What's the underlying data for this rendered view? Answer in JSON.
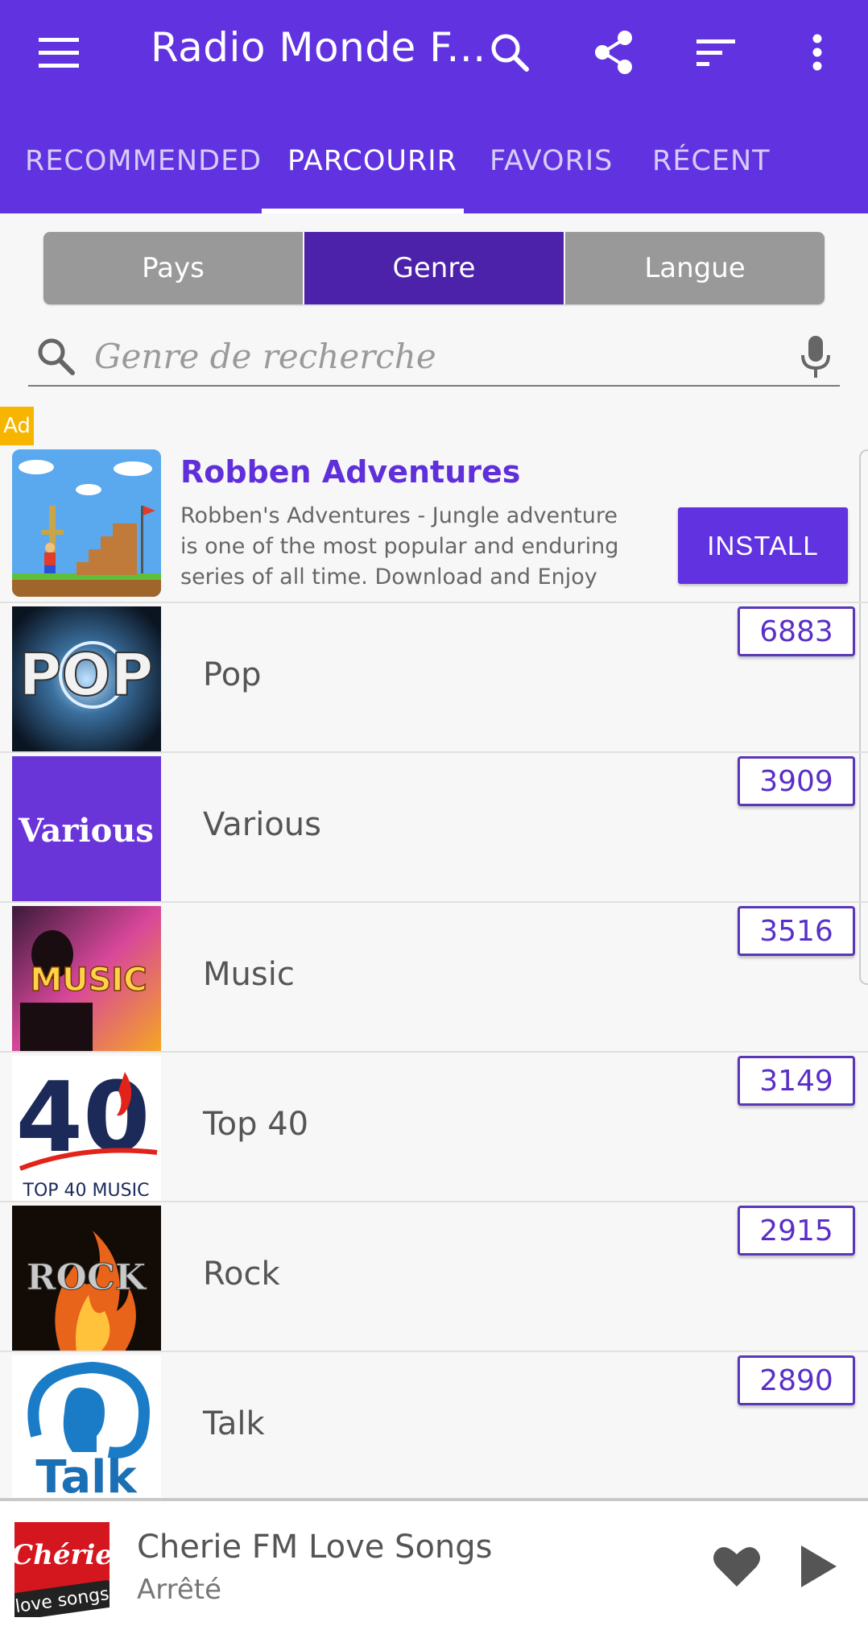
{
  "app": {
    "title": "Radio Monde F...",
    "accent_color": "#6132e0",
    "toolbar_icons": [
      "menu-icon",
      "search-icon",
      "share-icon",
      "sort-icon",
      "more-vert-icon"
    ]
  },
  "tabs": [
    {
      "label": "RECOMMENDED",
      "active": false
    },
    {
      "label": "PARCOURIR",
      "active": true
    },
    {
      "label": "FAVORIS",
      "active": false
    },
    {
      "label": "RÉCENT",
      "active": false
    }
  ],
  "segments": [
    {
      "label": "Pays",
      "active": false
    },
    {
      "label": "Genre",
      "active": true
    },
    {
      "label": "Langue",
      "active": false
    }
  ],
  "search": {
    "placeholder": "Genre de recherche",
    "value": ""
  },
  "ad": {
    "badge": "Ad",
    "title": "Robben Adventures",
    "description": "Robben's Adventures - Jungle adventure is one of the most popular and enduring series of all time. Download and Enjoy",
    "install_label": "INSTALL"
  },
  "genres": [
    {
      "name": "Pop",
      "count": "6883",
      "thumb_text": "POP"
    },
    {
      "name": "Various",
      "count": "3909",
      "thumb_text": "Various"
    },
    {
      "name": "Music",
      "count": "3516",
      "thumb_text": "MUSIC"
    },
    {
      "name": "Top 40",
      "count": "3149",
      "thumb_text": "40",
      "thumb_caption": "TOP 40 MUSIC"
    },
    {
      "name": "Rock",
      "count": "2915",
      "thumb_text": "ROCK"
    },
    {
      "name": "Talk",
      "count": "2890",
      "thumb_text": "Talk"
    }
  ],
  "player": {
    "logo_line1": "Chérie",
    "logo_line2": "love songs",
    "station": "Cherie FM Love Songs",
    "status": "Arrêté"
  }
}
